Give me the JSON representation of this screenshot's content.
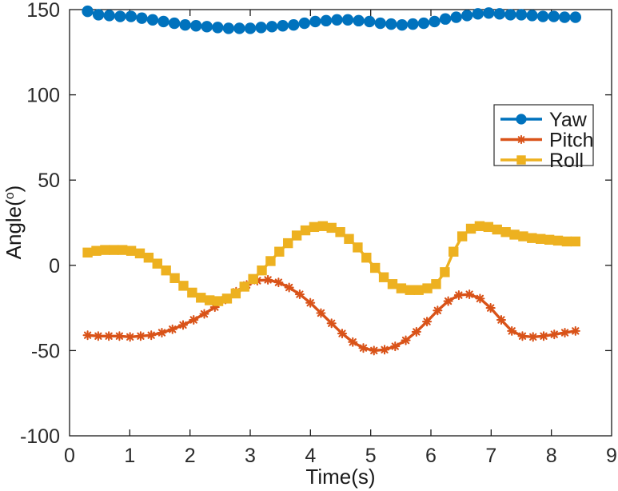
{
  "chart_data": {
    "type": "line",
    "title": "",
    "xlabel": "Time(s)",
    "ylabel": "Angle(°)",
    "xlim": [
      0,
      9
    ],
    "ylim": [
      -100,
      150
    ],
    "xticks": [
      0,
      1,
      2,
      3,
      4,
      5,
      6,
      7,
      8,
      9
    ],
    "yticks": [
      -100,
      -50,
      0,
      50,
      100,
      150
    ],
    "xtick_labels": [
      "0",
      "1",
      "2",
      "3",
      "4",
      "5",
      "6",
      "7",
      "8",
      "9"
    ],
    "ytick_labels": [
      "-100",
      "-50",
      "0",
      "50",
      "100",
      "150"
    ],
    "grid": false,
    "legend_position": "right-upper",
    "legend_entries": [
      "Yaw",
      "Pitch",
      "Roll"
    ],
    "colors": {
      "yaw": "#0072BD",
      "pitch": "#D95319",
      "roll": "#EDB120",
      "axis": "#1a1a1a",
      "background": "#ffffff"
    },
    "markers": {
      "yaw": "circle",
      "pitch": "asterisk",
      "roll": "square"
    },
    "x": [
      0.3,
      0.48,
      0.66,
      0.84,
      1.02,
      1.2,
      1.38,
      1.56,
      1.74,
      1.92,
      2.1,
      2.28,
      2.46,
      2.64,
      2.82,
      3.0,
      3.18,
      3.36,
      3.54,
      3.72,
      3.9,
      4.08,
      4.26,
      4.44,
      4.62,
      4.8,
      4.98,
      5.16,
      5.34,
      5.52,
      5.7,
      5.88,
      6.06,
      6.24,
      6.42,
      6.6,
      6.78,
      6.96,
      7.14,
      7.32,
      7.5,
      7.68,
      7.86,
      8.04,
      8.22,
      8.4
    ],
    "series": [
      {
        "name": "Yaw",
        "color": "#0072BD",
        "marker": "circle",
        "values": [
          149.0,
          147.0,
          146.5,
          146.0,
          146.0,
          145.0,
          144.0,
          143.0,
          142.0,
          141.0,
          140.5,
          140.0,
          139.5,
          139.0,
          139.0,
          139.0,
          139.5,
          140.0,
          140.5,
          141.0,
          142.0,
          143.0,
          143.5,
          144.0,
          144.0,
          143.5,
          143.0,
          142.0,
          141.5,
          141.0,
          141.5,
          142.0,
          143.0,
          144.5,
          145.5,
          146.5,
          147.5,
          148.0,
          147.5,
          147.0,
          147.0,
          146.5,
          146.0,
          146.0,
          145.5,
          145.5
        ]
      },
      {
        "name": "Pitch",
        "color": "#D95319",
        "marker": "asterisk",
        "values": [
          -41.0,
          -41.5,
          -41.5,
          -41.5,
          -42.0,
          -41.5,
          -41.0,
          -39.5,
          -37.5,
          -35.0,
          -32.0,
          -28.5,
          -24.5,
          -20.0,
          -15.5,
          -11.5,
          -9.0,
          -8.5,
          -10.0,
          -13.0,
          -17.0,
          -22.0,
          -28.0,
          -34.0,
          -40.0,
          -45.0,
          -48.5,
          -50.0,
          -49.5,
          -47.5,
          -44.0,
          -39.0,
          -33.0,
          -26.5,
          -21.0,
          -17.5,
          -17.0,
          -19.5,
          -25.0,
          -32.0,
          -38.5,
          -41.5,
          -42.0,
          -41.5,
          -40.5,
          -39.5,
          -38.5
        ]
      },
      {
        "name": "Roll",
        "color": "#EDB120",
        "marker": "square",
        "values": [
          7.5,
          8.5,
          9.0,
          9.0,
          9.0,
          8.5,
          7.0,
          4.5,
          1.0,
          -3.0,
          -7.5,
          -12.0,
          -16.0,
          -19.0,
          -20.5,
          -21.0,
          -19.5,
          -16.5,
          -12.5,
          -8.0,
          -3.0,
          2.5,
          8.0,
          13.0,
          17.5,
          20.5,
          22.5,
          23.0,
          22.0,
          19.5,
          15.5,
          10.5,
          4.5,
          -1.5,
          -7.0,
          -11.0,
          -13.5,
          -14.5,
          -14.5,
          -13.5,
          -11.0,
          -4.0,
          8.0,
          17.0,
          21.5,
          23.0,
          22.5,
          21.0,
          19.5,
          18.0,
          17.0,
          16.0,
          15.5,
          15.0,
          14.5,
          14.0,
          14.0
        ]
      }
    ]
  },
  "axes": {
    "x_title": "Time(s)",
    "y_title_main": "Angle(",
    "y_title_sup": "o",
    "y_title_end": ")"
  },
  "legend": {
    "items": [
      {
        "label": "Yaw",
        "color": "#0072BD",
        "marker": "circle"
      },
      {
        "label": "Pitch",
        "color": "#D95319",
        "marker": "asterisk"
      },
      {
        "label": "Roll",
        "color": "#EDB120",
        "marker": "square"
      }
    ]
  }
}
